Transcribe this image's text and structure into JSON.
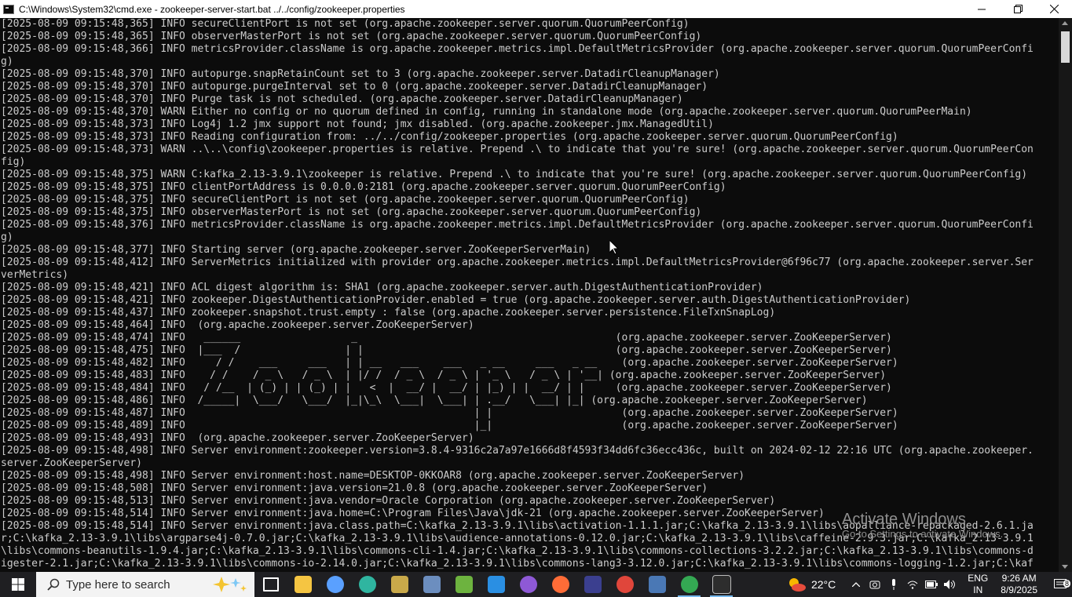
{
  "window": {
    "title": "C:\\Windows\\System32\\cmd.exe - zookeeper-server-start.bat  ../../config/zookeeper.properties"
  },
  "console": {
    "lines": [
      "[2025-08-09 09:15:48,365] INFO secureClientPort is not set (org.apache.zookeeper.server.quorum.QuorumPeerConfig)",
      "[2025-08-09 09:15:48,365] INFO observerMasterPort is not set (org.apache.zookeeper.server.quorum.QuorumPeerConfig)",
      "[2025-08-09 09:15:48,366] INFO metricsProvider.className is org.apache.zookeeper.metrics.impl.DefaultMetricsProvider (org.apache.zookeeper.server.quorum.QuorumPeerConfi",
      "g)",
      "[2025-08-09 09:15:48,370] INFO autopurge.snapRetainCount set to 3 (org.apache.zookeeper.server.DatadirCleanupManager)",
      "[2025-08-09 09:15:48,370] INFO autopurge.purgeInterval set to 0 (org.apache.zookeeper.server.DatadirCleanupManager)",
      "[2025-08-09 09:15:48,370] INFO Purge task is not scheduled. (org.apache.zookeeper.server.DatadirCleanupManager)",
      "[2025-08-09 09:15:48,370] WARN Either no config or no quorum defined in config, running in standalone mode (org.apache.zookeeper.server.quorum.QuorumPeerMain)",
      "[2025-08-09 09:15:48,373] INFO Log4j 1.2 jmx support not found; jmx disabled. (org.apache.zookeeper.jmx.ManagedUtil)",
      "[2025-08-09 09:15:48,373] INFO Reading configuration from: ../../config/zookeeper.properties (org.apache.zookeeper.server.quorum.QuorumPeerConfig)",
      "[2025-08-09 09:15:48,373] WARN ..\\..\\config\\zookeeper.properties is relative. Prepend .\\ to indicate that you're sure! (org.apache.zookeeper.server.quorum.QuorumPeerCon",
      "fig)",
      "[2025-08-09 09:15:48,375] WARN C:kafka_2.13-3.9.1\\zookeeper is relative. Prepend .\\ to indicate that you're sure! (org.apache.zookeeper.server.quorum.QuorumPeerConfig)",
      "[2025-08-09 09:15:48,375] INFO clientPortAddress is 0.0.0.0:2181 (org.apache.zookeeper.server.quorum.QuorumPeerConfig)",
      "[2025-08-09 09:15:48,375] INFO secureClientPort is not set (org.apache.zookeeper.server.quorum.QuorumPeerConfig)",
      "[2025-08-09 09:15:48,375] INFO observerMasterPort is not set (org.apache.zookeeper.server.quorum.QuorumPeerConfig)",
      "[2025-08-09 09:15:48,376] INFO metricsProvider.className is org.apache.zookeeper.metrics.impl.DefaultMetricsProvider (org.apache.zookeeper.server.quorum.QuorumPeerConfi",
      "g)",
      "[2025-08-09 09:15:48,377] INFO Starting server (org.apache.zookeeper.server.ZooKeeperServerMain)",
      "[2025-08-09 09:15:48,412] INFO ServerMetrics initialized with provider org.apache.zookeeper.metrics.impl.DefaultMetricsProvider@6f96c77 (org.apache.zookeeper.server.Ser",
      "verMetrics)",
      "[2025-08-09 09:15:48,421] INFO ACL digest algorithm is: SHA1 (org.apache.zookeeper.server.auth.DigestAuthenticationProvider)",
      "[2025-08-09 09:15:48,421] INFO zookeeper.DigestAuthenticationProvider.enabled = true (org.apache.zookeeper.server.auth.DigestAuthenticationProvider)",
      "[2025-08-09 09:15:48,437] INFO zookeeper.snapshot.trust.empty : false (org.apache.zookeeper.server.persistence.FileTxnSnapLog)",
      "[2025-08-09 09:15:48,464] INFO  (org.apache.zookeeper.server.ZooKeeperServer)",
      "[2025-08-09 09:15:48,474] INFO   ______                  _                                          (org.apache.zookeeper.server.ZooKeeperServer)",
      "[2025-08-09 09:15:48,475] INFO  |___  /                 | |                                         (org.apache.zookeeper.server.ZooKeeperServer)",
      "[2025-08-09 09:15:48,482] INFO     / /    ___     ___   | | __   ___    ___   _ __     ___   _ __    (org.apache.zookeeper.server.ZooKeeperServer)",
      "[2025-08-09 09:15:48,483] INFO    / /    / _ \\   / _ \\  | |/ /  / _ \\  / _ \\ | '_ \\   / _ \\ | '__| (org.apache.zookeeper.server.ZooKeeperServer)",
      "[2025-08-09 09:15:48,484] INFO   / /__  | (_) | | (_) | |   <  |  __/ |  __/ | |_) | |  __/ | |     (org.apache.zookeeper.server.ZooKeeperServer)",
      "[2025-08-09 09:15:48,486] INFO  /_____|  \\___/   \\___/  |_|\\_\\  \\___|  \\___| | .__/   \\___| |_| (org.apache.zookeeper.server.ZooKeeperServer)",
      "[2025-08-09 09:15:48,487] INFO                                               | |                     (org.apache.zookeeper.server.ZooKeeperServer)",
      "[2025-08-09 09:15:48,489] INFO                                               |_|                     (org.apache.zookeeper.server.ZooKeeperServer)",
      "[2025-08-09 09:15:48,493] INFO  (org.apache.zookeeper.server.ZooKeeperServer)",
      "[2025-08-09 09:15:48,498] INFO Server environment:zookeeper.version=3.8.4-9316c2a7a97e1666d8f4593f34dd6fc36ecc436c, built on 2024-02-12 22:16 UTC (org.apache.zookeeper.",
      "server.ZooKeeperServer)",
      "[2025-08-09 09:15:48,498] INFO Server environment:host.name=DESKTOP-0KKOAR8 (org.apache.zookeeper.server.ZooKeeperServer)",
      "[2025-08-09 09:15:48,508] INFO Server environment:java.version=21.0.8 (org.apache.zookeeper.server.ZooKeeperServer)",
      "[2025-08-09 09:15:48,513] INFO Server environment:java.vendor=Oracle Corporation (org.apache.zookeeper.server.ZooKeeperServer)",
      "[2025-08-09 09:15:48,514] INFO Server environment:java.home=C:\\Program Files\\Java\\jdk-21 (org.apache.zookeeper.server.ZooKeeperServer)",
      "[2025-08-09 09:15:48,514] INFO Server environment:java.class.path=C:\\kafka_2.13-3.9.1\\libs\\activation-1.1.1.jar;C:\\kafka_2.13-3.9.1\\libs\\aopalliance-repackaged-2.6.1.ja",
      "r;C:\\kafka_2.13-3.9.1\\libs\\argparse4j-0.7.0.jar;C:\\kafka_2.13-3.9.1\\libs\\audience-annotations-0.12.0.jar;C:\\kafka_2.13-3.9.1\\libs\\caffeine-2.9.3.jar;C:\\kafka_2.13-3.9.1",
      "\\libs\\commons-beanutils-1.9.4.jar;C:\\kafka_2.13-3.9.1\\libs\\commons-cli-1.4.jar;C:\\kafka_2.13-3.9.1\\libs\\commons-collections-3.2.2.jar;C:\\kafka_2.13-3.9.1\\libs\\commons-d",
      "igester-2.1.jar;C:\\kafka_2.13-3.9.1\\libs\\commons-io-2.14.0.jar;C:\\kafka_2.13-3.9.1\\libs\\commons-lang3-3.12.0.jar;C:\\kafka_2.13-3.9.1\\libs\\commons-logging-1.2.jar;C:\\kaf"
    ]
  },
  "watermark": {
    "title": "Activate Windows",
    "subtitle": "Go to Settings to activate Windows."
  },
  "taskbar": {
    "search_placeholder": "Type here to search",
    "apps": [
      {
        "name": "task-view",
        "color": "#ffffff"
      },
      {
        "name": "file-explorer",
        "color": "#f5c542"
      },
      {
        "name": "copilot",
        "color": "#5aa0ff"
      },
      {
        "name": "edge",
        "color": "#2fb5a0"
      },
      {
        "name": "snipping-tool",
        "color": "#c9a94a"
      },
      {
        "name": "mysql-workbench",
        "color": "#6c8ebf"
      },
      {
        "name": "spring-tools",
        "color": "#6db33f"
      },
      {
        "name": "vscode",
        "color": "#2a8fe3"
      },
      {
        "name": "github-desktop",
        "color": "#8e59d6"
      },
      {
        "name": "postman",
        "color": "#ff6c37"
      },
      {
        "name": "eclipse",
        "color": "#3b3f8f"
      },
      {
        "name": "chrome",
        "color": "#e0463b"
      },
      {
        "name": "sql-developer",
        "color": "#4a78b5"
      },
      {
        "name": "chrome-profile",
        "color": "#34a853"
      },
      {
        "name": "cmd",
        "color": "#2d2d2d"
      }
    ],
    "weather": {
      "temp": "22°C"
    },
    "language": {
      "line1": "ENG",
      "line2": "IN"
    },
    "clock": {
      "time": "9:26 AM",
      "date": "8/9/2025"
    },
    "notifications": {
      "count": "8"
    }
  }
}
